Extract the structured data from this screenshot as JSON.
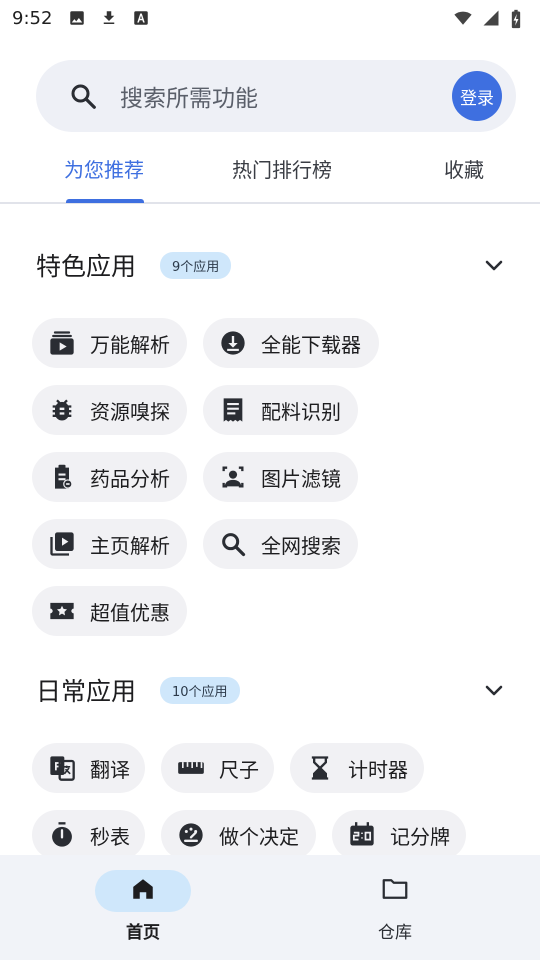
{
  "status_bar": {
    "time": "9:52",
    "left_icons": [
      "image-icon",
      "download-icon",
      "text-a-icon"
    ],
    "right_icons": [
      "wifi-icon",
      "signal-icon",
      "battery-charging-icon"
    ]
  },
  "search": {
    "placeholder": "搜索所需功能",
    "login_label": "登录"
  },
  "tabs": [
    {
      "label": "为您推荐",
      "active": true
    },
    {
      "label": "热门排行榜",
      "active": false
    },
    {
      "label": "收藏",
      "active": false
    }
  ],
  "sections": [
    {
      "title": "特色应用",
      "badge": "9个应用",
      "items": [
        {
          "label": "万能解析",
          "icon": "video-stack-icon"
        },
        {
          "label": "全能下载器",
          "icon": "download-circle-icon"
        },
        {
          "label": "资源嗅探",
          "icon": "bug-icon"
        },
        {
          "label": "配料识别",
          "icon": "receipt-icon"
        },
        {
          "label": "药品分析",
          "icon": "medical-doc-icon"
        },
        {
          "label": "图片滤镜",
          "icon": "face-filter-icon"
        },
        {
          "label": "主页解析",
          "icon": "video-library-icon"
        },
        {
          "label": "全网搜索",
          "icon": "search-icon"
        },
        {
          "label": "超值优惠",
          "icon": "coupon-icon"
        }
      ]
    },
    {
      "title": "日常应用",
      "badge": "10个应用",
      "items": [
        {
          "label": "翻译",
          "icon": "translate-icon"
        },
        {
          "label": "尺子",
          "icon": "ruler-icon"
        },
        {
          "label": "计时器",
          "icon": "hourglass-icon"
        },
        {
          "label": "秒表",
          "icon": "stopwatch-icon"
        },
        {
          "label": "做个决定",
          "icon": "decision-dial-icon"
        },
        {
          "label": "记分牌",
          "icon": "scoreboard-icon"
        }
      ]
    }
  ],
  "bottom_nav": [
    {
      "label": "首页",
      "icon": "home-icon",
      "active": true
    },
    {
      "label": "仓库",
      "icon": "folder-icon",
      "active": false
    }
  ],
  "colors": {
    "accent": "#3e6fe0",
    "badge_bg": "#cfe7fb",
    "chip_bg": "#f1f1f4",
    "search_bg": "#eef0f6",
    "nav_bg": "#f1f3f8"
  }
}
